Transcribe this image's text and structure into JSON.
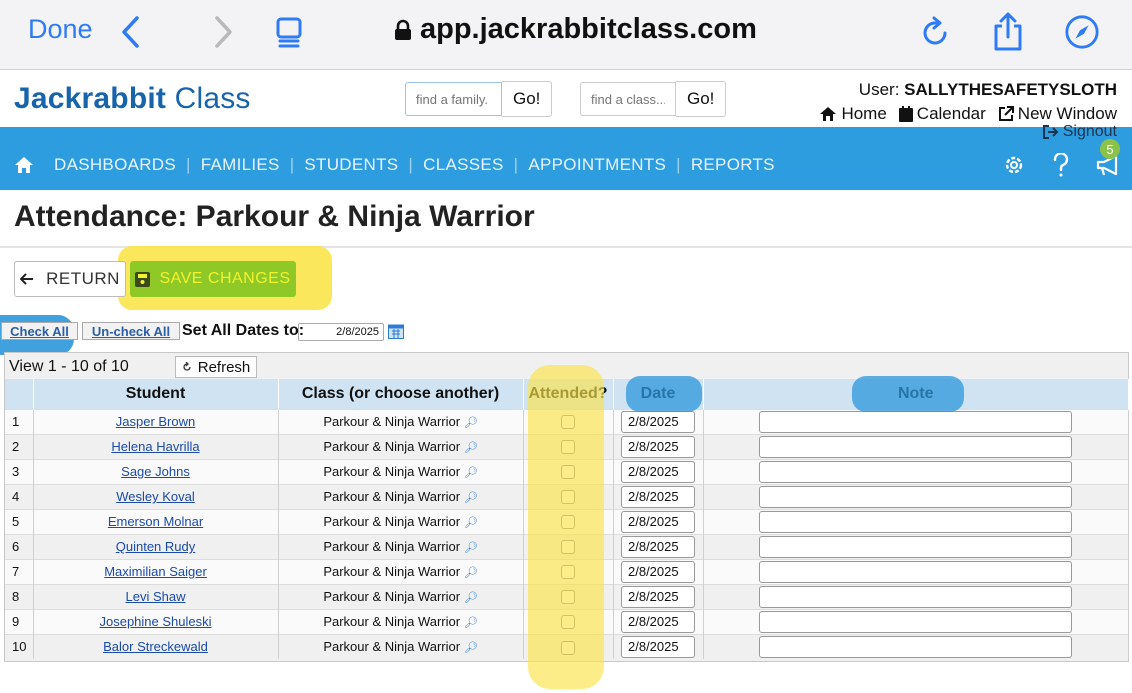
{
  "browser": {
    "done_label": "Done",
    "url": "app.jackrabbitclass.com"
  },
  "header": {
    "brand_bold": "Jackrabbit",
    "brand_light": " Class",
    "family_search": {
      "placeholder": "find a family.",
      "go_label": "Go!"
    },
    "class_search": {
      "placeholder": "find a class...",
      "go_label": "Go!"
    },
    "user_label": "User:",
    "user_name": "SALLYTHESAFETYSLOTH",
    "home_label": "Home",
    "calendar_label": "Calendar",
    "new_window_label": "New Window",
    "signout_label": "Signout"
  },
  "nav": {
    "items": [
      "DASHBOARDS",
      "FAMILIES",
      "STUDENTS",
      "CLASSES",
      "APPOINTMENTS",
      "REPORTS"
    ],
    "notification_count": "5"
  },
  "page": {
    "title": "Attendance: Parkour & Ninja Warrior",
    "return_label": "RETURN",
    "save_label": "SAVE CHANGES",
    "check_all_label": "Check All",
    "uncheck_all_label": "Un-check All",
    "set_dates_label": "Set All Dates to:",
    "set_dates_value": "2/8/2025",
    "view_text": "View 1 - 10 of 10",
    "refresh_label": "Refresh"
  },
  "table": {
    "headers": {
      "student": "Student",
      "class": "Class (or choose another)",
      "attended": "Attended?",
      "date": "Date",
      "note": "Note"
    },
    "rows": [
      {
        "num": "1",
        "student": "Jasper Brown",
        "class": "Parkour & Ninja Warrior",
        "date": "2/8/2025"
      },
      {
        "num": "2",
        "student": "Helena Havrilla",
        "class": "Parkour & Ninja Warrior",
        "date": "2/8/2025"
      },
      {
        "num": "3",
        "student": "Sage Johns",
        "class": "Parkour & Ninja Warrior",
        "date": "2/8/2025"
      },
      {
        "num": "4",
        "student": "Wesley Koval",
        "class": "Parkour & Ninja Warrior",
        "date": "2/8/2025"
      },
      {
        "num": "5",
        "student": "Emerson Molnar",
        "class": "Parkour & Ninja Warrior",
        "date": "2/8/2025"
      },
      {
        "num": "6",
        "student": "Quinten Rudy",
        "class": "Parkour & Ninja Warrior",
        "date": "2/8/2025"
      },
      {
        "num": "7",
        "student": "Maximilian Saiger",
        "class": "Parkour & Ninja Warrior",
        "date": "2/8/2025"
      },
      {
        "num": "8",
        "student": "Levi Shaw",
        "class": "Parkour & Ninja Warrior",
        "date": "2/8/2025"
      },
      {
        "num": "9",
        "student": "Josephine Shuleski",
        "class": "Parkour & Ninja Warrior",
        "date": "2/8/2025"
      },
      {
        "num": "10",
        "student": "Balor Streckewald",
        "class": "Parkour & Ninja Warrior",
        "date": "2/8/2025"
      }
    ]
  },
  "colors": {
    "brand_blue": "#1864ab",
    "nav_blue": "#2e9de0",
    "save_green": "#8fc928",
    "highlight_yellow": "#fbe44a",
    "highlight_blue": "#2c97dc"
  }
}
